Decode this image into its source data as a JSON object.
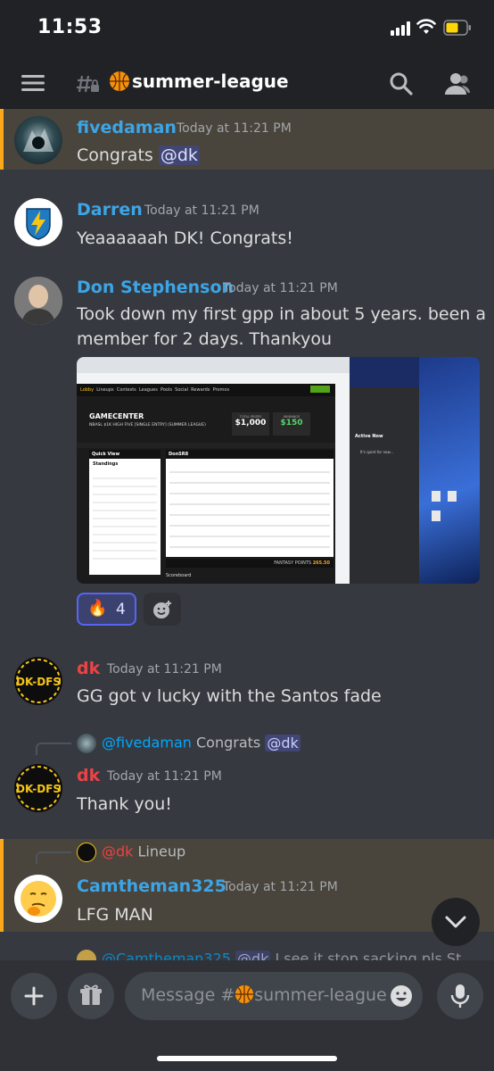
{
  "status": {
    "time": "11:53"
  },
  "channel": {
    "name": "summer-league"
  },
  "messages": [
    {
      "author": "fivedaman",
      "author_color": "#3ca5e6",
      "time": "Today at 11:21 PM",
      "text": "Congrats ",
      "mention": "@dk"
    },
    {
      "author": "Darren",
      "author_color": "#3ca5e6",
      "time": "Today at 11:21 PM",
      "text": "Yeaaaaaah DK! Congrats!"
    },
    {
      "author": "Don Stephenson",
      "author_color": "#3ca5e6",
      "time": "Today at 11:21 PM",
      "text_line1": "Took down my first gpp in about 5 years.  been a",
      "text_line2": "member for 2 days.  Thankyou"
    },
    {
      "author": "dk",
      "author_color": "#ed4245",
      "time": "Today at 11:21 PM",
      "text": "GG got v lucky with the Santos fade"
    },
    {
      "author": "dk",
      "author_color": "#ed4245",
      "time": "Today at 11:21 PM",
      "text": "Thank you!",
      "reply": {
        "name": "@fivedaman",
        "text": "Congrats ",
        "mention": "@dk"
      }
    },
    {
      "author": "Camtheman325",
      "author_color": "#3ca5e6",
      "time": "Today at 11:21 PM",
      "text": "LFG MAN",
      "reply": {
        "name": "@dk",
        "text": "Lineup"
      }
    },
    {
      "partial_reply": {
        "name": "@Camtheman325",
        "mention": "@dk",
        "text": "I see it stop sacking pls St"
      }
    }
  ],
  "avatars": {
    "dk_text": "DK-DFS"
  },
  "reaction": {
    "emoji": "🔥",
    "count": "4"
  },
  "input": {
    "placeholder_prefix": "Message #",
    "placeholder_channel": "summer-league"
  },
  "screenshot": {
    "nav": [
      "Lobby",
      "Lineups",
      "Contests",
      "Leagues",
      "Pools",
      "Social",
      "Rewards",
      "Promos"
    ],
    "title": "GAMECENTER",
    "contest": "NBASL $1K HIGH FIVE [SINGLE ENTRY] (SUMMER LEAGUE)",
    "total_prizes_label": "TOTAL PRIZES",
    "total_prizes": "$1,000",
    "winnings_label": "WINNINGS",
    "winnings": "$150",
    "quick_view": "Quick View",
    "standings": "Standings",
    "user": "DonSR8",
    "fantasy_points_label": "FANTASY POINTS",
    "fantasy_points": "265.50",
    "scoreboard": "Scoreboard",
    "active_now": "Active Now",
    "quiet": "It's quiet for now..."
  }
}
